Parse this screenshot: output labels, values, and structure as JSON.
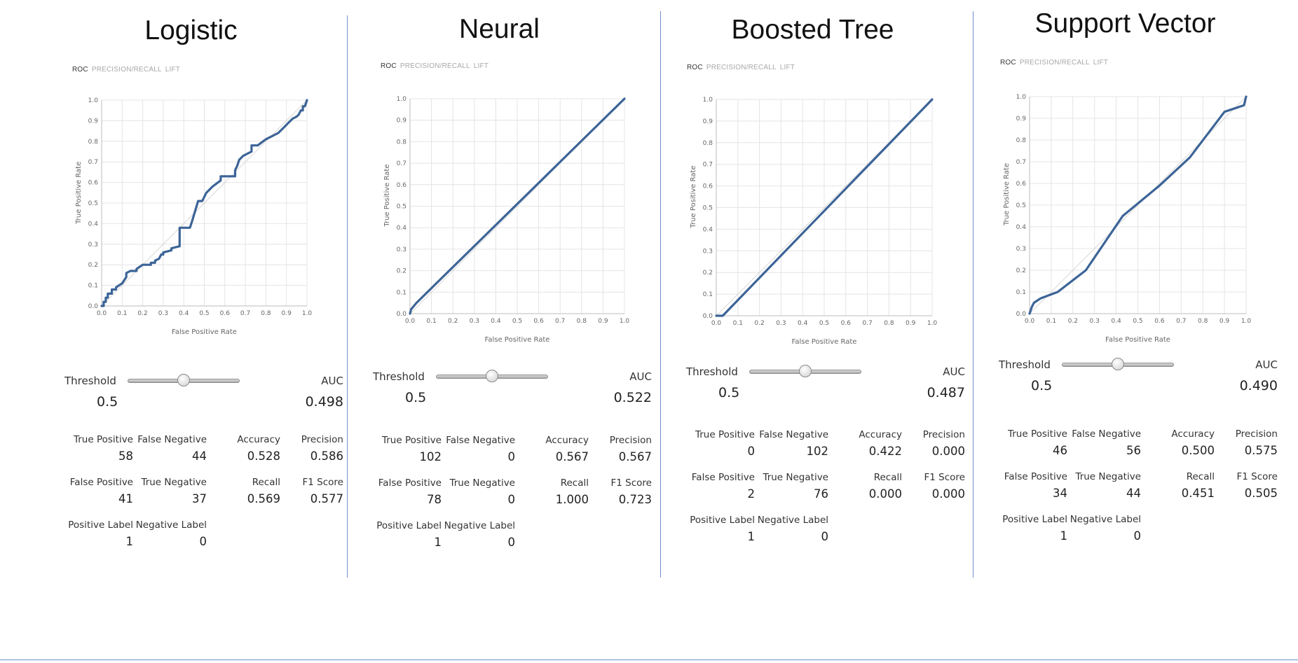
{
  "tabs": [
    "ROC",
    "PRECISION/RECALL",
    "LIFT"
  ],
  "axis": {
    "xlabel": "False Positive Rate",
    "ylabel": "True Positive Rate",
    "ticks": [
      "0.0",
      "0.1",
      "0.2",
      "0.3",
      "0.4",
      "0.5",
      "0.6",
      "0.7",
      "0.8",
      "0.9",
      "1.0"
    ]
  },
  "labels": {
    "threshold": "Threshold",
    "auc": "AUC",
    "tp": "True Positive",
    "fn": "False Negative",
    "accuracy": "Accuracy",
    "precision": "Precision",
    "fp": "False Positive",
    "tn": "True Negative",
    "recall": "Recall",
    "f1": "F1 Score",
    "poslabel": "Positive Label",
    "neglabel": "Negative Label"
  },
  "colors": {
    "curve": "#3c6497",
    "grid": "#e4e4e4",
    "separator": "#6f8fcf"
  },
  "models": [
    {
      "title": "Logistic",
      "threshold": "0.5",
      "auc": "0.498",
      "tp": "58",
      "fn": "44",
      "accuracy": "0.528",
      "precision": "0.586",
      "fp": "41",
      "tn": "37",
      "recall": "0.569",
      "f1": "0.577",
      "poslabel": "1",
      "neglabel": "0",
      "slider_value": 0.5
    },
    {
      "title": "Neural",
      "threshold": "0.5",
      "auc": "0.522",
      "tp": "102",
      "fn": "0",
      "accuracy": "0.567",
      "precision": "0.567",
      "fp": "78",
      "tn": "0",
      "recall": "1.000",
      "f1": "0.723",
      "poslabel": "1",
      "neglabel": "0",
      "slider_value": 0.5
    },
    {
      "title": "Boosted Tree",
      "threshold": "0.5",
      "auc": "0.487",
      "tp": "0",
      "fn": "102",
      "accuracy": "0.422",
      "precision": "0.000",
      "fp": "2",
      "tn": "76",
      "recall": "0.000",
      "f1": "0.000",
      "poslabel": "1",
      "neglabel": "0",
      "slider_value": 0.5
    },
    {
      "title": "Support Vector",
      "threshold": "0.5",
      "auc": "0.490",
      "tp": "46",
      "fn": "56",
      "accuracy": "0.500",
      "precision": "0.575",
      "fp": "34",
      "tn": "44",
      "recall": "0.451",
      "f1": "0.505",
      "poslabel": "1",
      "neglabel": "0",
      "slider_value": 0.5
    }
  ],
  "chart_data": [
    {
      "type": "line",
      "xlabel": "False Positive Rate",
      "ylabel": "True Positive Rate",
      "xlim": [
        0,
        1
      ],
      "ylim": [
        0,
        1
      ],
      "grid": true,
      "series": [
        {
          "x": [
            0,
            0.01,
            0.01,
            0.02,
            0.02,
            0.03,
            0.03,
            0.05,
            0.05,
            0.07,
            0.07,
            0.1,
            0.12,
            0.12,
            0.14,
            0.17,
            0.17,
            0.2,
            0.24,
            0.24,
            0.26,
            0.26,
            0.28,
            0.29,
            0.3,
            0.3,
            0.34,
            0.34,
            0.38,
            0.38,
            0.43,
            0.44,
            0.47,
            0.49,
            0.5,
            0.51,
            0.52,
            0.54,
            0.58,
            0.58,
            0.65,
            0.65,
            0.66,
            0.67,
            0.69,
            0.73,
            0.73,
            0.76,
            0.8,
            0.82,
            0.82,
            0.84,
            0.86,
            0.87,
            0.88,
            0.89,
            0.9,
            0.91,
            0.92,
            0.93,
            0.95,
            0.96,
            0.97,
            0.98,
            0.98,
            0.99,
            1.0
          ],
          "y": [
            0,
            0,
            0.02,
            0.02,
            0.04,
            0.04,
            0.06,
            0.06,
            0.08,
            0.08,
            0.09,
            0.11,
            0.14,
            0.16,
            0.17,
            0.17,
            0.18,
            0.2,
            0.2,
            0.21,
            0.21,
            0.22,
            0.23,
            0.25,
            0.25,
            0.26,
            0.27,
            0.28,
            0.29,
            0.38,
            0.38,
            0.41,
            0.51,
            0.51,
            0.53,
            0.55,
            0.56,
            0.58,
            0.61,
            0.63,
            0.63,
            0.66,
            0.68,
            0.71,
            0.73,
            0.75,
            0.78,
            0.78,
            0.81,
            0.82,
            0.82,
            0.83,
            0.84,
            0.85,
            0.86,
            0.87,
            0.88,
            0.89,
            0.9,
            0.91,
            0.92,
            0.93,
            0.95,
            0.95,
            0.97,
            0.97,
            1.0
          ]
        }
      ]
    },
    {
      "type": "line",
      "xlabel": "False Positive Rate",
      "ylabel": "True Positive Rate",
      "xlim": [
        0,
        1
      ],
      "ylim": [
        0,
        1
      ],
      "grid": true,
      "series": [
        {
          "x": [
            0,
            0.005,
            0.03,
            1.0
          ],
          "y": [
            0,
            0.02,
            0.05,
            1.0
          ]
        }
      ]
    },
    {
      "type": "line",
      "xlabel": "False Positive Rate",
      "ylabel": "True Positive Rate",
      "xlim": [
        0,
        1
      ],
      "ylim": [
        0,
        1
      ],
      "grid": true,
      "series": [
        {
          "x": [
            0,
            0.03,
            1.0
          ],
          "y": [
            0,
            0,
            1.0
          ]
        }
      ]
    },
    {
      "type": "line",
      "xlabel": "False Positive Rate",
      "ylabel": "True Positive Rate",
      "xlim": [
        0,
        1
      ],
      "ylim": [
        0,
        1
      ],
      "grid": true,
      "series": [
        {
          "x": [
            0,
            0.01,
            0.02,
            0.05,
            0.13,
            0.26,
            0.43,
            0.6,
            0.74,
            0.9,
            0.99,
            1.0
          ],
          "y": [
            0,
            0.03,
            0.05,
            0.07,
            0.1,
            0.2,
            0.45,
            0.59,
            0.72,
            0.93,
            0.96,
            1.0
          ]
        }
      ]
    }
  ]
}
